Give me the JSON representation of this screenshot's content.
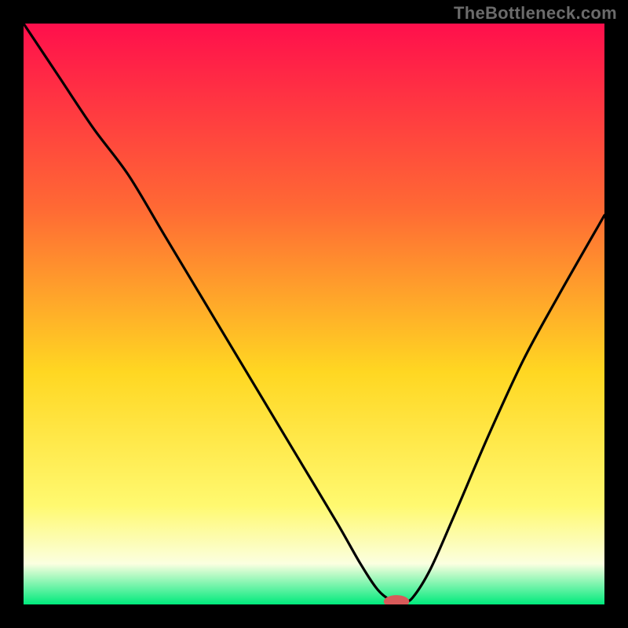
{
  "watermark": "TheBottleneck.com",
  "colors": {
    "frame_bg": "#000000",
    "gradient_top": "#ff0f4c",
    "gradient_upper_mid": "#ff6a34",
    "gradient_mid": "#ffd722",
    "gradient_lower_mid": "#fff970",
    "gradient_cream": "#fbffe0",
    "gradient_bottom": "#00ea7c",
    "curve_stroke": "#000000",
    "marker_fill": "#d85a5a"
  },
  "chart_data": {
    "type": "line",
    "title": "",
    "xlabel": "",
    "ylabel": "",
    "xlim": [
      0,
      100
    ],
    "ylim": [
      0,
      100
    ],
    "series": [
      {
        "name": "bottleneck-curve",
        "x": [
          0,
          6,
          12,
          18,
          24,
          30,
          36,
          42,
          48,
          54,
          58,
          61,
          63.5,
          65.5,
          67,
          70,
          74,
          80,
          86,
          92,
          100
        ],
        "y": [
          100,
          91,
          82,
          74,
          64,
          54,
          44,
          34,
          24,
          14,
          7,
          2.5,
          0.6,
          0.5,
          1.2,
          6,
          15,
          29,
          42,
          53,
          67
        ]
      }
    ],
    "marker": {
      "x": 64.2,
      "y": 0.5,
      "rx": 2.2,
      "ry": 1.1
    }
  }
}
